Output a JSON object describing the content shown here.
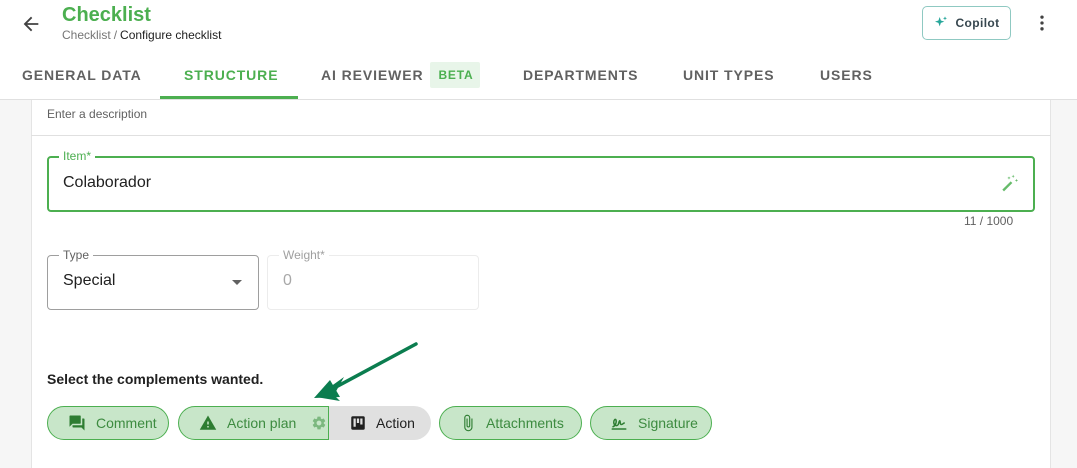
{
  "header": {
    "title": "Checklist",
    "breadcrumb": {
      "parent": "Checklist",
      "separator": "/",
      "current": "Configure checklist"
    },
    "copilot_label": "Copilot",
    "icons": {
      "back": "arrow-left-icon",
      "copilot": "sparkle-icon",
      "more": "more-vertical-icon"
    }
  },
  "tabs": [
    {
      "label": "GENERAL DATA",
      "active": false
    },
    {
      "label": "STRUCTURE",
      "active": true
    },
    {
      "label": "AI REVIEWER",
      "badge": "BETA",
      "active": false
    },
    {
      "label": "DEPARTMENTS",
      "active": false
    },
    {
      "label": "UNIT TYPES",
      "active": false
    },
    {
      "label": "USERS",
      "active": false
    }
  ],
  "form": {
    "description_placeholder": "Enter a description",
    "item": {
      "label": "Item*",
      "value": "Colaborador",
      "counter": "11 / 1000",
      "icon": "magic-wand-icon"
    },
    "type": {
      "label": "Type",
      "value": "Special"
    },
    "weight": {
      "label": "Weight*",
      "value": "0"
    },
    "complements_title": "Select the complements wanted.",
    "complements": {
      "comment": {
        "label": "Comment",
        "icon": "comment-icon",
        "selected": true
      },
      "action_plan": {
        "label": "Action plan",
        "icon": "warning-icon",
        "settings_icon": "gear-icon",
        "selected": true
      },
      "action": {
        "label": "Action",
        "icon": "kanban-icon",
        "selected": false
      },
      "attachments": {
        "label": "Attachments",
        "icon": "paperclip-icon",
        "selected": true
      },
      "signature": {
        "label": "Signature",
        "icon": "signature-icon",
        "selected": true
      }
    }
  },
  "colors": {
    "accent": "#4caf50",
    "chip_bg": "#c8e6c9",
    "annotation_arrow": "#0b7d4f"
  }
}
